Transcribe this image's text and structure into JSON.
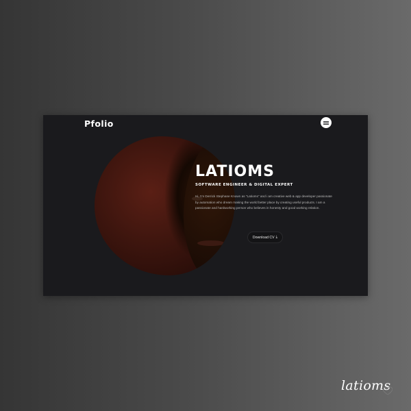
{
  "header": {
    "logo": "Pfolio",
    "menu_icon": "hamburger-menu-icon"
  },
  "hero": {
    "title": "LATIOMS",
    "subtitle": "SOFTWARE ENGINEER & DIGITAL EXPERT",
    "bio": "Hi, I'm Derrick Stephane Known as \"Latioms\" and i am creative web & app developer passionate by automation who dream making the world better place by creating useful products. I am a passionate and hardworking person who believes in honesty and good working relation.",
    "download_label": "Download CV",
    "download_icon": "download-icon"
  },
  "branding": {
    "signature": "latioms",
    "like_icon": "heart-icon"
  },
  "colors": {
    "page_bg_left": "#353535",
    "page_bg_right": "#6a6a6a",
    "frame_bg": "#1a1a1d",
    "portrait_accent": "#5a1f15",
    "text_primary": "#ffffff",
    "text_muted": "#b9b9b9"
  }
}
